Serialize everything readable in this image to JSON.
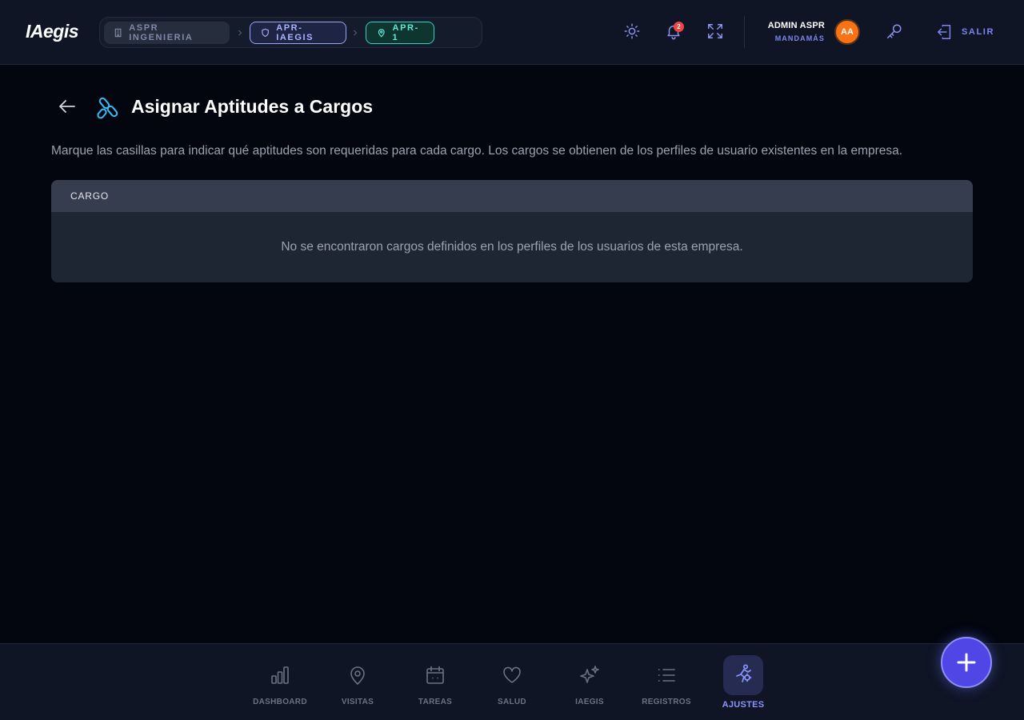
{
  "app": {
    "logo": "IAegis"
  },
  "breadcrumb": {
    "company": "ASPR INGENIERIA",
    "project": "APR-IAEGIS",
    "site": "APR-1"
  },
  "header": {
    "notifications_count": "2",
    "user_name": "ADMIN ASPR",
    "user_role": "MANDAMÁS",
    "avatar_initials": "AA",
    "logout_label": "SALIR",
    "icons": [
      "sun-icon",
      "bell-icon",
      "expand-icon",
      "key-icon",
      "logout-icon"
    ]
  },
  "page": {
    "title": "Asignar Aptitudes a Cargos",
    "description": "Marque las casillas para indicar qué aptitudes son requeridas para cada cargo. Los cargos se obtienen de los perfiles de usuario existentes en la empresa.",
    "table": {
      "column_header": "CARGO",
      "empty_message": "No se encontraron cargos definidos en los perfiles de los usuarios de esta empresa."
    }
  },
  "nav": {
    "items": [
      {
        "label": "DASHBOARD",
        "icon": "bar-chart-icon"
      },
      {
        "label": "VISITAS",
        "icon": "map-pin-icon"
      },
      {
        "label": "TAREAS",
        "icon": "calendar-icon"
      },
      {
        "label": "SALUD",
        "icon": "heart-icon"
      },
      {
        "label": "IAEGIS",
        "icon": "sparkles-icon"
      },
      {
        "label": "REGISTROS",
        "icon": "list-icon"
      },
      {
        "label": "AJUSTES",
        "icon": "settings-figure-icon",
        "active": true
      }
    ]
  },
  "colors": {
    "accent": "#8b94ff",
    "fab": "#4f46e5",
    "site_chip": "#2dd4bf",
    "avatar": "#f97316",
    "badge": "#ef4444"
  }
}
